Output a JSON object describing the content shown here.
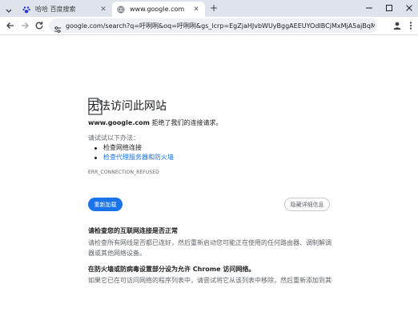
{
  "tabs": [
    {
      "title": "哈哈 百度搜索",
      "icon": "paw-icon",
      "active": false
    },
    {
      "title": "www.google.com",
      "icon": "page-icon",
      "active": true
    }
  ],
  "address_bar": {
    "url": "google.com/search?q=吁咧咧&oq=吁咧咧&gs_lcrp=EgZjaHJvbWUyBggAEEUYOdIBCjMxMjA5ajBqMWToAgCw..."
  },
  "error_page": {
    "title": "无法访问此网站",
    "host": "www.google.com",
    "description_suffix": " 拒绝了我们的连接请求。",
    "try_label": "请试试以下办法：",
    "suggestions": [
      {
        "text": "检查网络连接",
        "link": false
      },
      {
        "text": "检查代理服务器和防火墙",
        "link": true
      }
    ],
    "error_code": "ERR_CONNECTION_REFUSED",
    "reload_label": "重新加载",
    "details_label": "隐藏详细信息",
    "section1_heading": "请检查您的互联网连接是否正常",
    "section1_text": "请检查所有网线是否都已连好，然后重新启动您可能正在使用的任何路由器、调制解调器或其他网络设备。",
    "section2_heading": "在防火墙或防病毒设置部分设为允许 Chrome 访问网络。",
    "section2_text": "如果它已在可访问网络的程序列表中，请尝试将它从该列表中移除，然后重新添加到其中。"
  },
  "colors": {
    "tabstrip": "#dfe3eb",
    "accent": "#1a73e8",
    "omnibox": "#edf0f5"
  }
}
